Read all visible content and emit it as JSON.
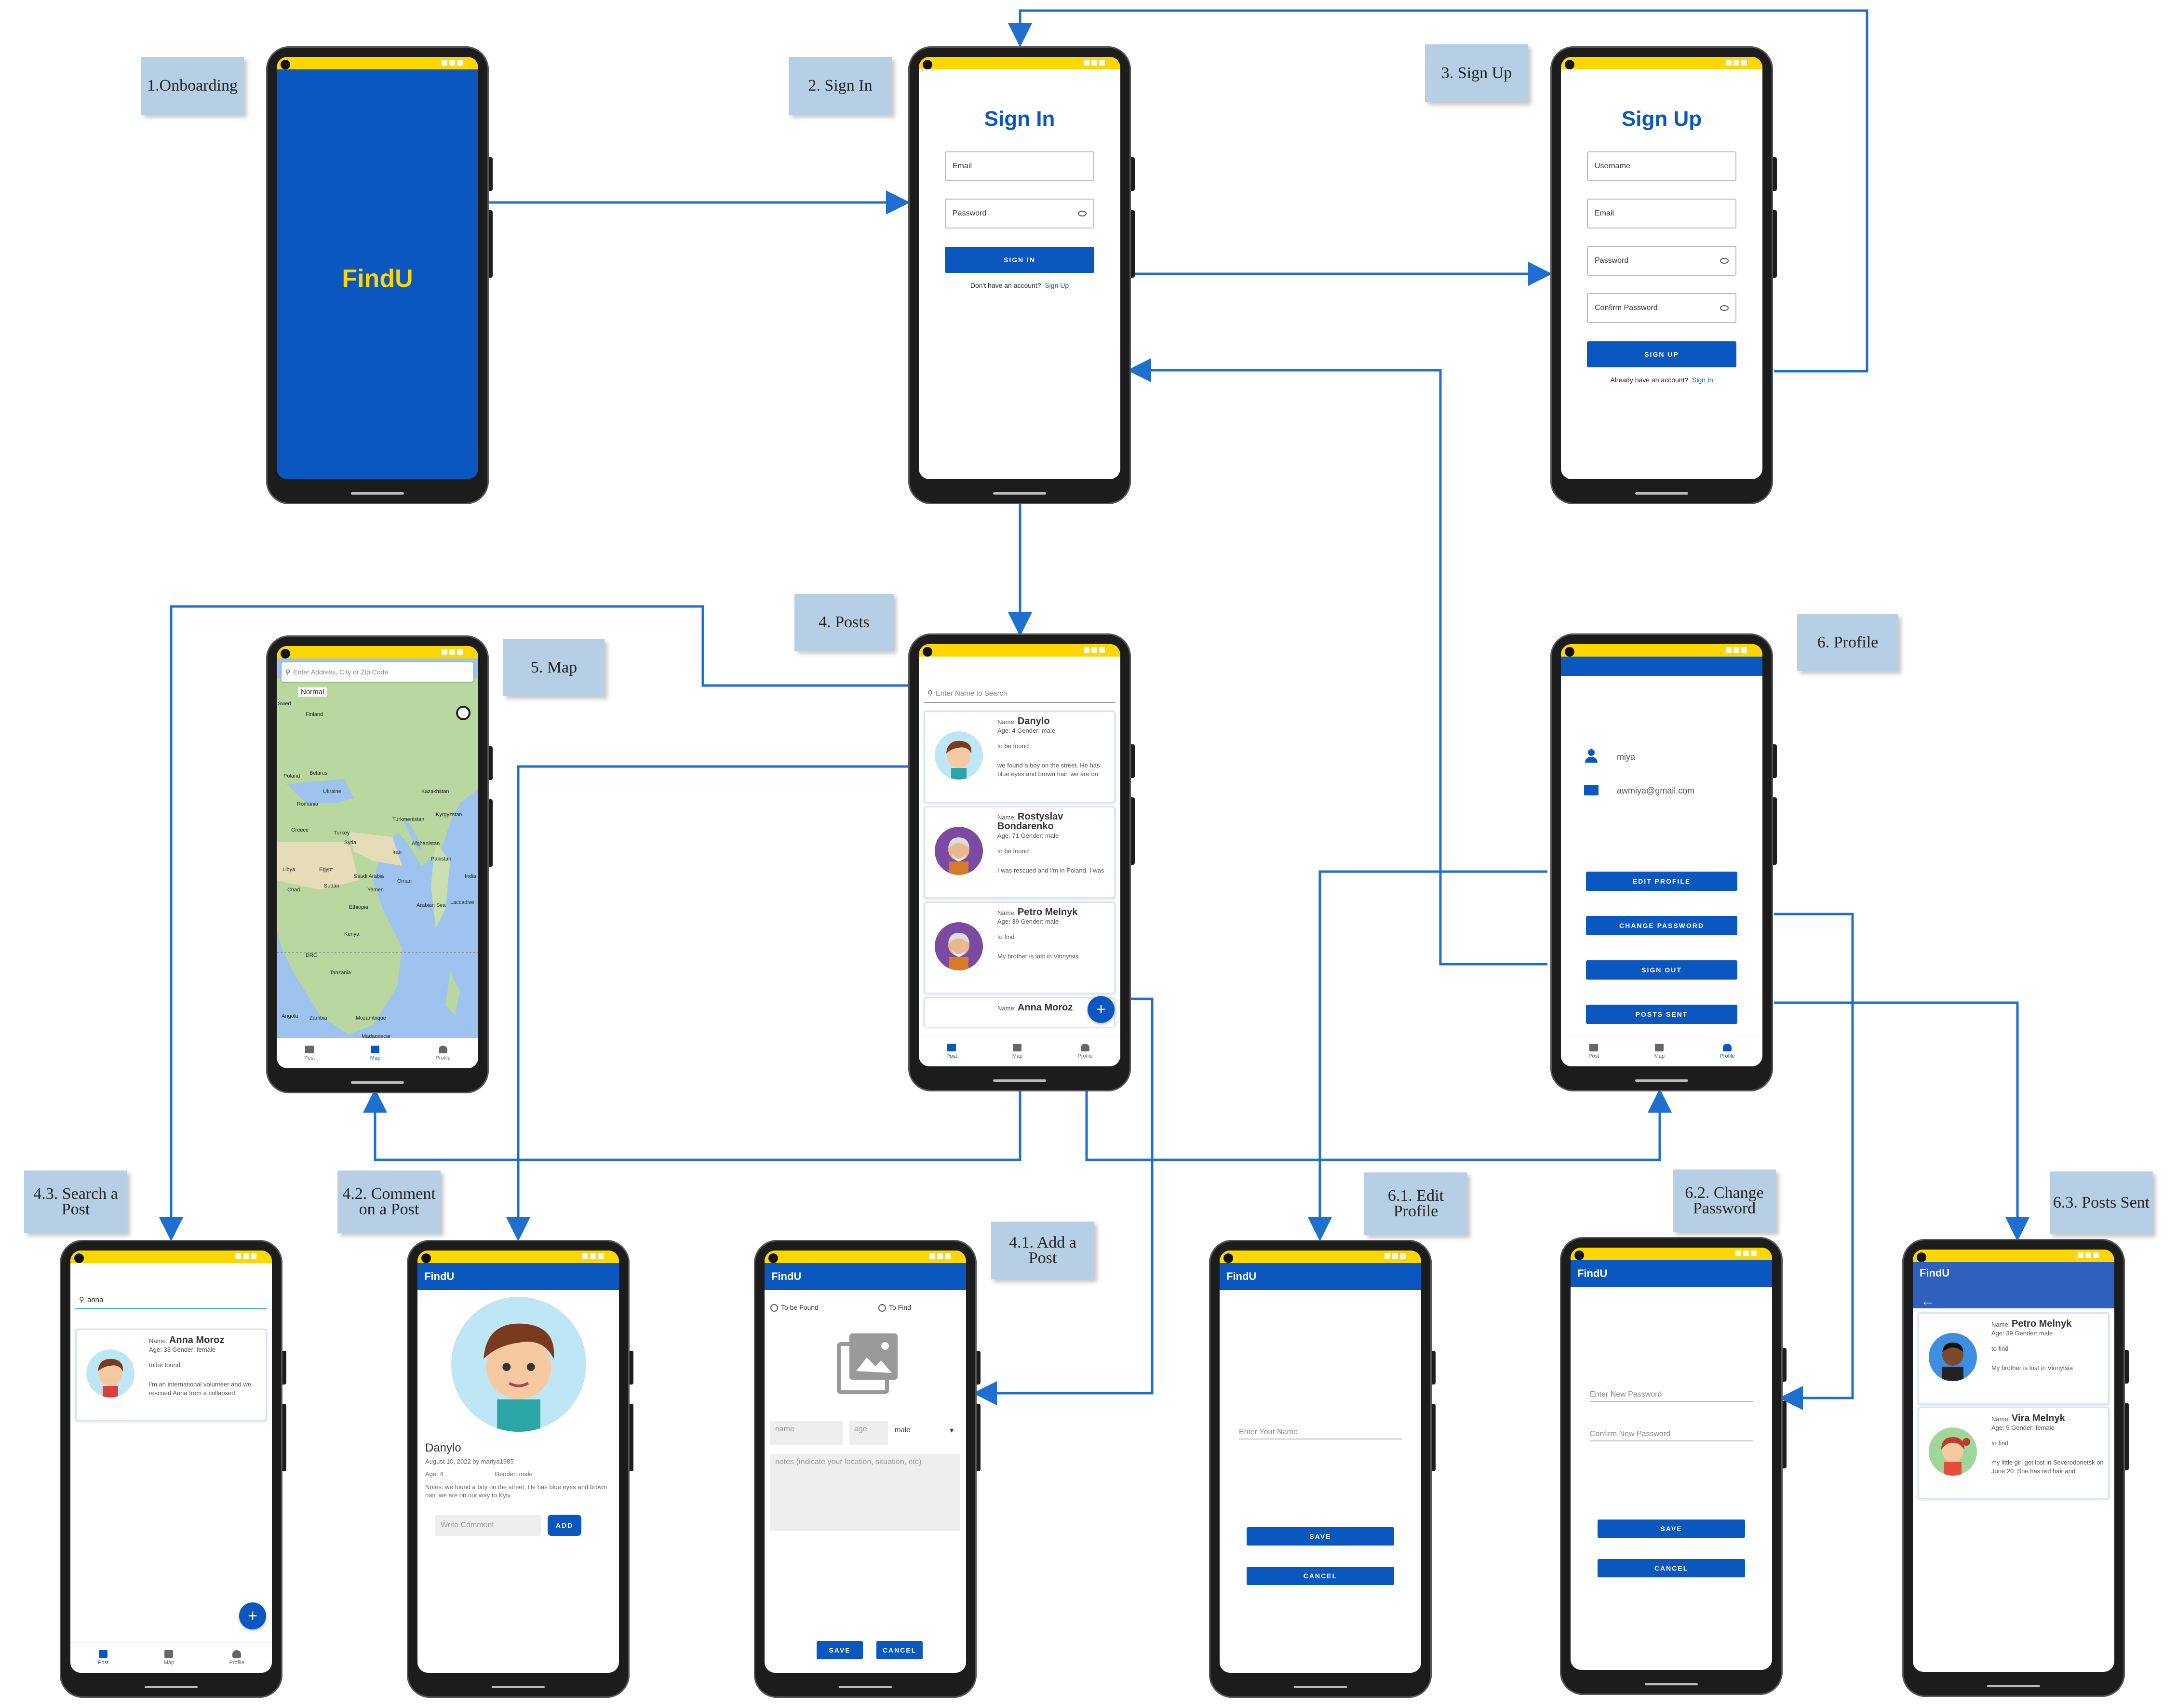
{
  "app_name": "FindU",
  "labels": {
    "onboarding": "1.Onboarding",
    "sign_in": "2. Sign In",
    "sign_up": "3. Sign Up",
    "posts": "4. Posts",
    "map": "5. Map",
    "profile": "6. Profile",
    "search_post": "4.3. Search a Post",
    "comment_post": "4.2. Comment on a Post",
    "add_post": "4.1. Add a Post",
    "edit_profile": "6.1. Edit Profile",
    "change_password": "6.2. Change Password",
    "posts_sent": "6.3. Posts Sent"
  },
  "signin": {
    "title": "Sign In",
    "email": "Email",
    "password": "Password",
    "button": "SIGN IN",
    "prompt": "Don't have an account?",
    "link": "Sign Up"
  },
  "signup": {
    "title": "Sign Up",
    "username": "Username",
    "email": "Email",
    "password": "Password",
    "confirm": "Confirm Password",
    "button": "SIGN UP",
    "prompt": "Already have an account?",
    "link": "Sign In"
  },
  "posts": {
    "search_placeholder": "Enter Name to Search",
    "cards": [
      {
        "name": "Danylo",
        "age_gender": "Age: 4   Gender: male",
        "status": "to be found",
        "notes": "we found a boy on the street. He has blue eyes and brown hair. we are on",
        "avatar": "boy-avatar"
      },
      {
        "name": "Rostyslav Bondarenko",
        "age_gender": "Age: 71   Gender: male",
        "status": "to be found",
        "notes": "I was rescued and I'm in Poland. I was",
        "avatar": "elder-avatar"
      },
      {
        "name": "Petro Melnyk",
        "age_gender": "Age: 39   Gender: male",
        "status": "to find",
        "notes": "My brother is lost in Vinnytsia",
        "avatar": "elder-avatar"
      },
      {
        "name": "Anna Moroz",
        "age_gender": "",
        "status": "",
        "notes": "",
        "avatar": ""
      }
    ],
    "name_prefix": "Name:"
  },
  "nav": {
    "post": "Post",
    "map": "Map",
    "profile": "Profile"
  },
  "map": {
    "search_placeholder": "Enter Address, City or Zip Code",
    "mode": "Normal",
    "places": [
      "Swed",
      "Finland",
      "Poland",
      "Belarus",
      "Ukraine",
      "Romania",
      "Kazakhstan",
      "Turkmenistan",
      "Kyrgyzstan",
      "Greece",
      "Turkey",
      "Syria",
      "Iran",
      "Afghanistan",
      "Pakistan",
      "Libya",
      "Egypt",
      "Saudi Arabia",
      "Oman",
      "India",
      "Chad",
      "Sudan",
      "Yemen",
      "Arabian Sea",
      "Ethiopia",
      "Kenya",
      "DRC",
      "Tanzania",
      "Angola",
      "Zambia",
      "Mozambique",
      "Madagascar",
      "Botswana",
      "Laccadive",
      "Indian Ocea"
    ]
  },
  "profile": {
    "username": "miya",
    "email": "awmiya@gmail.com",
    "edit": "EDIT PROFILE",
    "change_pw": "CHANGE PASSWORD",
    "sign_out": "SIGN OUT",
    "posts_sent": "POSTS SENT"
  },
  "search": {
    "query": "anna",
    "card": {
      "name": "Anna Moroz",
      "age_gender": "Age: 33   Gender: female",
      "status": "to be found",
      "notes": "I'm an international volunteer and we rescued Anna from a collapsed"
    }
  },
  "comment": {
    "name": "Danylo",
    "meta": "August 10, 2022 by mariya1985",
    "age": "Age: 4",
    "gender": "Gender: male",
    "notes": "Notes: we found a boy on the street. He has blue eyes and brown hair. we are on our way to Kyiv.",
    "placeholder": "Write Comment",
    "button": "ADD"
  },
  "addpost": {
    "opt1": "To be Found",
    "opt2": "To Find",
    "name": "name",
    "age": "age",
    "gender": "male",
    "notes": "notes (indicate your location, situation, etc)",
    "save": "SAVE",
    "cancel": "CANCEL"
  },
  "editprofile": {
    "placeholder": "Enter Your Name",
    "save": "SAVE",
    "cancel": "CANCEL"
  },
  "changepw": {
    "new": "Enter New Password",
    "confirm": "Confirm New Password",
    "save": "SAVE",
    "cancel": "CANCEL"
  },
  "postssent": {
    "cards": [
      {
        "name": "Petro Melnyk",
        "age_gender": "Age: 39   Gender: male",
        "status": "to find",
        "notes": "My brother is lost in Vinnytsia"
      },
      {
        "name": "Vira Melnyk",
        "age_gender": "Age: 5   Gender: female",
        "status": "to find",
        "notes": "my little girl got lost in Severodonetsk on June 20. She has red hair and"
      }
    ]
  },
  "colors": {
    "primary": "#0b57c0",
    "status": "#ffd700",
    "wire": "#1f6fd1",
    "note": "#b6cfe4"
  }
}
